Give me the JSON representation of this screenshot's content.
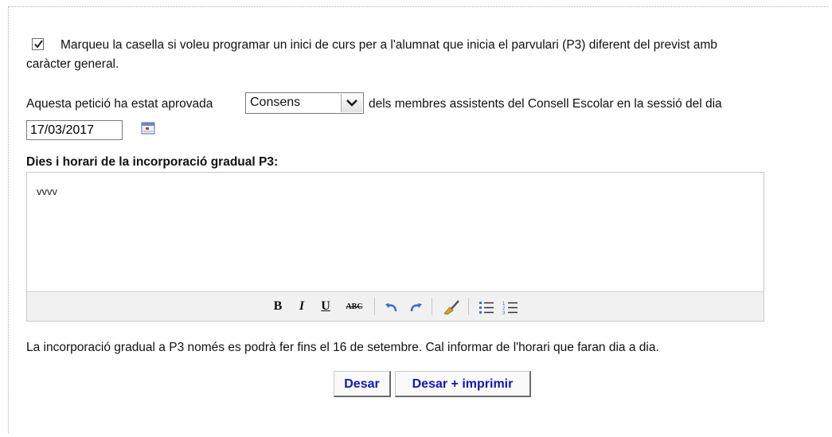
{
  "program_checkbox": {
    "checked": true,
    "label_line1": "Marqueu la casella si voleu programar un inici de curs per a l'alumnat que inicia el parvulari (P3) diferent del previst amb",
    "label_line2": "caràcter general."
  },
  "approval": {
    "prefix": "Aquesta petició ha estat aprovada",
    "selected_option": "Consens",
    "suffix": "dels membres assistents del Consell Escolar en la sessió del dia",
    "date_value": "17/03/2017"
  },
  "schedule": {
    "heading": "Dies i horari de la incorporació gradual P3:",
    "editor_content": "vvvv",
    "toolbar": {
      "bold": "B",
      "italic": "I",
      "underline": "U",
      "strike": "ABC"
    }
  },
  "note": "La incorporació gradual a P3 només es podrà fer fins el 16 de setembre. Cal informar de l'horari que faran dia a dia.",
  "buttons": {
    "save": "Desar",
    "save_print": "Desar + imprimir"
  },
  "colors": {
    "button_text": "#1418a8",
    "icon_blue": "#3a6fc4"
  }
}
